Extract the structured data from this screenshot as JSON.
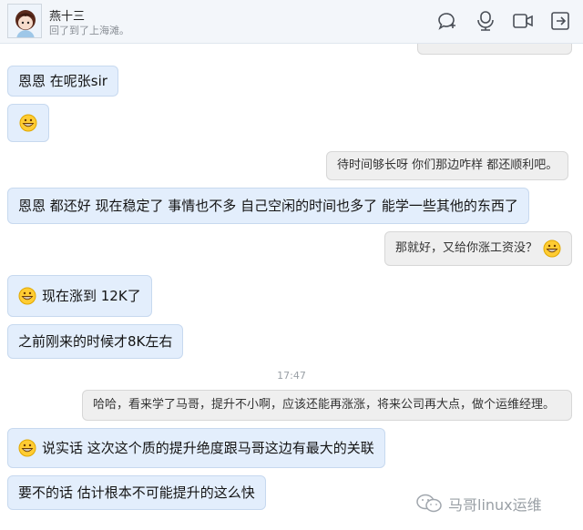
{
  "contact": {
    "name": "燕十三",
    "status": "回了到了上海滩。"
  },
  "header_icons": [
    "add-chat-icon",
    "voice-icon",
    "video-icon",
    "share-screen-icon"
  ],
  "messages": [
    {
      "side": "in",
      "text": "恩恩 在呢张sir"
    },
    {
      "side": "in",
      "emoji": "grin-emoji",
      "text": ""
    },
    {
      "side": "out",
      "text": "待时间够长呀 你们那边咋样 都还顺利吧。"
    },
    {
      "side": "in",
      "text": "恩恩 都还好 现在稳定了  事情也不多 自己空闲的时间也多了 能学一些其他的东西了"
    },
    {
      "side": "out",
      "text": "那就好，又给你涨工资没？",
      "emoji": "grin-emoji"
    },
    {
      "side": "in",
      "emoji": "grin-emoji",
      "text": "现在涨到 12K了"
    },
    {
      "side": "in",
      "text": "之前刚来的时候才8K左右"
    },
    {
      "side": "out",
      "text": "哈哈，看来学了马哥，提升不小啊，应该还能再涨涨，将来公司再大点，做个运维经理。"
    },
    {
      "side": "in",
      "emoji": "grin-emoji",
      "text": "说实话 这次这个质的提升绝度跟马哥这边有最大的关联"
    },
    {
      "side": "in",
      "text": "要不的话 估计根本不可能提升的这么快"
    }
  ],
  "timestamp": "17:47",
  "watermark": "马哥linux运维"
}
